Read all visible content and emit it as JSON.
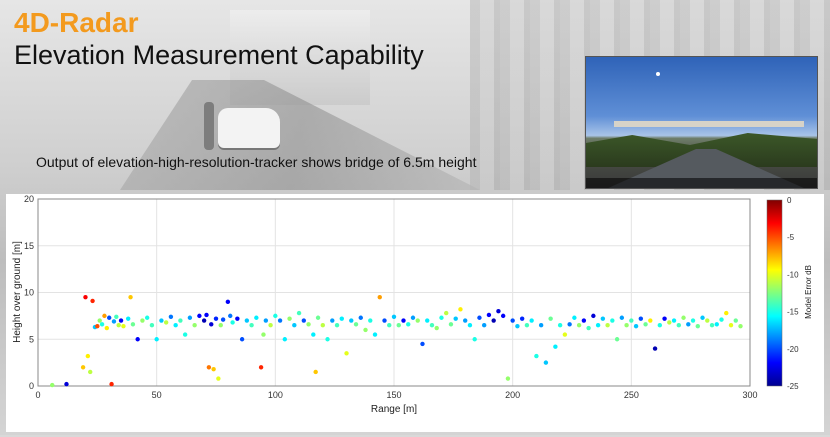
{
  "header": {
    "brand": "4D-Radar",
    "title": "Elevation Measurement Capability"
  },
  "caption": "Output of elevation-high-resolution-tracker shows bridge of 6.5m height",
  "colors": {
    "brand": "#f39a1e"
  },
  "chart_data": {
    "type": "scatter",
    "xlabel": "Range [m]",
    "ylabel": "Height over ground [m]",
    "xlim": [
      0,
      300
    ],
    "ylim": [
      0,
      20
    ],
    "xticks": [
      0,
      50,
      100,
      150,
      200,
      250,
      300
    ],
    "yticks": [
      0,
      5,
      10,
      15,
      20
    ],
    "grid": true,
    "colorbar": {
      "label": "Model Error dB",
      "range": [
        -25,
        0
      ],
      "ticks": [
        0,
        -5,
        -10,
        -15,
        -20,
        -25
      ]
    },
    "points": [
      {
        "x": 6,
        "y": 0.1,
        "c": -12
      },
      {
        "x": 12,
        "y": 0.2,
        "c": -23
      },
      {
        "x": 19,
        "y": 2,
        "c": -8
      },
      {
        "x": 20,
        "y": 9.5,
        "c": -3
      },
      {
        "x": 21,
        "y": 3.2,
        "c": -9
      },
      {
        "x": 22,
        "y": 1.5,
        "c": -11
      },
      {
        "x": 23,
        "y": 9.1,
        "c": -4
      },
      {
        "x": 24,
        "y": 6.3,
        "c": -17
      },
      {
        "x": 25,
        "y": 6.4,
        "c": -5
      },
      {
        "x": 26,
        "y": 7,
        "c": -12
      },
      {
        "x": 27,
        "y": 6.6,
        "c": -15
      },
      {
        "x": 28,
        "y": 7.5,
        "c": -7
      },
      {
        "x": 29,
        "y": 6.2,
        "c": -9
      },
      {
        "x": 30,
        "y": 7.3,
        "c": -20
      },
      {
        "x": 31,
        "y": 0.2,
        "c": -4
      },
      {
        "x": 32,
        "y": 6.9,
        "c": -18
      },
      {
        "x": 33,
        "y": 7.4,
        "c": -14
      },
      {
        "x": 34,
        "y": 6.5,
        "c": -11
      },
      {
        "x": 35,
        "y": 7,
        "c": -22
      },
      {
        "x": 36,
        "y": 6.4,
        "c": -10
      },
      {
        "x": 38,
        "y": 7.2,
        "c": -16
      },
      {
        "x": 39,
        "y": 9.5,
        "c": -8
      },
      {
        "x": 40,
        "y": 6.6,
        "c": -13
      },
      {
        "x": 42,
        "y": 5,
        "c": -22
      },
      {
        "x": 44,
        "y": 7,
        "c": -12
      },
      {
        "x": 46,
        "y": 7.3,
        "c": -15
      },
      {
        "x": 48,
        "y": 6.5,
        "c": -14
      },
      {
        "x": 50,
        "y": 5,
        "c": -16
      },
      {
        "x": 52,
        "y": 7,
        "c": -17
      },
      {
        "x": 54,
        "y": 6.8,
        "c": -11
      },
      {
        "x": 56,
        "y": 7.4,
        "c": -19
      },
      {
        "x": 58,
        "y": 6.5,
        "c": -16
      },
      {
        "x": 60,
        "y": 7,
        "c": -14
      },
      {
        "x": 62,
        "y": 5.5,
        "c": -15
      },
      {
        "x": 64,
        "y": 7.3,
        "c": -18
      },
      {
        "x": 66,
        "y": 6.5,
        "c": -12
      },
      {
        "x": 68,
        "y": 7.5,
        "c": -22
      },
      {
        "x": 70,
        "y": 7,
        "c": -24
      },
      {
        "x": 71,
        "y": 7.6,
        "c": -22
      },
      {
        "x": 72,
        "y": 2,
        "c": -6
      },
      {
        "x": 73,
        "y": 6.6,
        "c": -23
      },
      {
        "x": 74,
        "y": 1.8,
        "c": -8
      },
      {
        "x": 75,
        "y": 7.2,
        "c": -21
      },
      {
        "x": 76,
        "y": 0.8,
        "c": -10
      },
      {
        "x": 77,
        "y": 6.5,
        "c": -12
      },
      {
        "x": 78,
        "y": 7.1,
        "c": -20
      },
      {
        "x": 80,
        "y": 9,
        "c": -22
      },
      {
        "x": 81,
        "y": 7.5,
        "c": -19
      },
      {
        "x": 82,
        "y": 6.8,
        "c": -15
      },
      {
        "x": 84,
        "y": 7.2,
        "c": -22
      },
      {
        "x": 86,
        "y": 5,
        "c": -20
      },
      {
        "x": 88,
        "y": 7,
        "c": -17
      },
      {
        "x": 90,
        "y": 6.5,
        "c": -14
      },
      {
        "x": 92,
        "y": 7.3,
        "c": -16
      },
      {
        "x": 94,
        "y": 2,
        "c": -4
      },
      {
        "x": 95,
        "y": 5.5,
        "c": -12
      },
      {
        "x": 96,
        "y": 7,
        "c": -18
      },
      {
        "x": 98,
        "y": 6.5,
        "c": -11
      },
      {
        "x": 100,
        "y": 7.5,
        "c": -15
      },
      {
        "x": 102,
        "y": 7,
        "c": -19
      },
      {
        "x": 104,
        "y": 5,
        "c": -16
      },
      {
        "x": 106,
        "y": 7.2,
        "c": -12
      },
      {
        "x": 108,
        "y": 6.5,
        "c": -17
      },
      {
        "x": 110,
        "y": 7.8,
        "c": -14
      },
      {
        "x": 112,
        "y": 7,
        "c": -20
      },
      {
        "x": 114,
        "y": 6.6,
        "c": -12
      },
      {
        "x": 116,
        "y": 5.5,
        "c": -16
      },
      {
        "x": 117,
        "y": 1.5,
        "c": -8
      },
      {
        "x": 118,
        "y": 7.3,
        "c": -13
      },
      {
        "x": 120,
        "y": 6.5,
        "c": -11
      },
      {
        "x": 122,
        "y": 5,
        "c": -15
      },
      {
        "x": 124,
        "y": 7,
        "c": -18
      },
      {
        "x": 126,
        "y": 6.5,
        "c": -14
      },
      {
        "x": 128,
        "y": 7.2,
        "c": -16
      },
      {
        "x": 130,
        "y": 3.5,
        "c": -10
      },
      {
        "x": 132,
        "y": 7,
        "c": -17
      },
      {
        "x": 134,
        "y": 6.6,
        "c": -13
      },
      {
        "x": 136,
        "y": 7.3,
        "c": -19
      },
      {
        "x": 138,
        "y": 6,
        "c": -12
      },
      {
        "x": 140,
        "y": 7,
        "c": -15
      },
      {
        "x": 142,
        "y": 5.5,
        "c": -16
      },
      {
        "x": 144,
        "y": 9.5,
        "c": -7
      },
      {
        "x": 146,
        "y": 7,
        "c": -20
      },
      {
        "x": 148,
        "y": 6.5,
        "c": -14
      },
      {
        "x": 150,
        "y": 7.4,
        "c": -17
      },
      {
        "x": 152,
        "y": 6.5,
        "c": -13
      },
      {
        "x": 154,
        "y": 7,
        "c": -22
      },
      {
        "x": 156,
        "y": 6.6,
        "c": -15
      },
      {
        "x": 158,
        "y": 7.3,
        "c": -18
      },
      {
        "x": 160,
        "y": 7,
        "c": -12
      },
      {
        "x": 162,
        "y": 4.5,
        "c": -20
      },
      {
        "x": 164,
        "y": 7,
        "c": -16
      },
      {
        "x": 166,
        "y": 6.5,
        "c": -14
      },
      {
        "x": 168,
        "y": 6.2,
        "c": -12
      },
      {
        "x": 170,
        "y": 7.3,
        "c": -15
      },
      {
        "x": 172,
        "y": 7.8,
        "c": -11
      },
      {
        "x": 174,
        "y": 6.6,
        "c": -13
      },
      {
        "x": 176,
        "y": 7.2,
        "c": -17
      },
      {
        "x": 178,
        "y": 8.2,
        "c": -9
      },
      {
        "x": 180,
        "y": 7,
        "c": -18
      },
      {
        "x": 182,
        "y": 6.5,
        "c": -16
      },
      {
        "x": 184,
        "y": 5,
        "c": -15
      },
      {
        "x": 186,
        "y": 7.3,
        "c": -20
      },
      {
        "x": 188,
        "y": 6.5,
        "c": -18
      },
      {
        "x": 190,
        "y": 7.6,
        "c": -22
      },
      {
        "x": 192,
        "y": 7,
        "c": -24
      },
      {
        "x": 194,
        "y": 8,
        "c": -23
      },
      {
        "x": 196,
        "y": 7.5,
        "c": -22
      },
      {
        "x": 198,
        "y": 0.8,
        "c": -12
      },
      {
        "x": 200,
        "y": 7,
        "c": -20
      },
      {
        "x": 202,
        "y": 6.4,
        "c": -17
      },
      {
        "x": 204,
        "y": 7.2,
        "c": -21
      },
      {
        "x": 206,
        "y": 6.5,
        "c": -14
      },
      {
        "x": 208,
        "y": 7,
        "c": -16
      },
      {
        "x": 210,
        "y": 3.2,
        "c": -15
      },
      {
        "x": 212,
        "y": 6.5,
        "c": -18
      },
      {
        "x": 214,
        "y": 2.5,
        "c": -17
      },
      {
        "x": 216,
        "y": 7.2,
        "c": -13
      },
      {
        "x": 218,
        "y": 4.2,
        "c": -16
      },
      {
        "x": 220,
        "y": 6.5,
        "c": -15
      },
      {
        "x": 222,
        "y": 5.5,
        "c": -10
      },
      {
        "x": 224,
        "y": 6.6,
        "c": -19
      },
      {
        "x": 226,
        "y": 7.3,
        "c": -16
      },
      {
        "x": 228,
        "y": 6.5,
        "c": -12
      },
      {
        "x": 230,
        "y": 7,
        "c": -22
      },
      {
        "x": 232,
        "y": 6.2,
        "c": -14
      },
      {
        "x": 234,
        "y": 7.5,
        "c": -23
      },
      {
        "x": 236,
        "y": 6.5,
        "c": -16
      },
      {
        "x": 238,
        "y": 7.2,
        "c": -17
      },
      {
        "x": 240,
        "y": 6.5,
        "c": -11
      },
      {
        "x": 242,
        "y": 7,
        "c": -15
      },
      {
        "x": 244,
        "y": 5,
        "c": -13
      },
      {
        "x": 246,
        "y": 7.3,
        "c": -18
      },
      {
        "x": 248,
        "y": 6.5,
        "c": -12
      },
      {
        "x": 250,
        "y": 7,
        "c": -14
      },
      {
        "x": 252,
        "y": 6.4,
        "c": -17
      },
      {
        "x": 254,
        "y": 7.2,
        "c": -20
      },
      {
        "x": 256,
        "y": 6.6,
        "c": -13
      },
      {
        "x": 258,
        "y": 7,
        "c": -9
      },
      {
        "x": 260,
        "y": 4,
        "c": -24
      },
      {
        "x": 262,
        "y": 6.5,
        "c": -15
      },
      {
        "x": 264,
        "y": 7.2,
        "c": -22
      },
      {
        "x": 266,
        "y": 6.8,
        "c": -11
      },
      {
        "x": 268,
        "y": 7,
        "c": -16
      },
      {
        "x": 270,
        "y": 6.5,
        "c": -14
      },
      {
        "x": 272,
        "y": 7.3,
        "c": -12
      },
      {
        "x": 274,
        "y": 6.6,
        "c": -18
      },
      {
        "x": 276,
        "y": 7,
        "c": -15
      },
      {
        "x": 278,
        "y": 6.4,
        "c": -13
      },
      {
        "x": 280,
        "y": 7.3,
        "c": -17
      },
      {
        "x": 282,
        "y": 7,
        "c": -11
      },
      {
        "x": 284,
        "y": 6.5,
        "c": -14
      },
      {
        "x": 286,
        "y": 6.6,
        "c": -16
      },
      {
        "x": 288,
        "y": 7.1,
        "c": -15
      },
      {
        "x": 290,
        "y": 7.8,
        "c": -9
      },
      {
        "x": 292,
        "y": 6.5,
        "c": -10
      },
      {
        "x": 294,
        "y": 7,
        "c": -13
      },
      {
        "x": 296,
        "y": 6.4,
        "c": -12
      }
    ]
  }
}
